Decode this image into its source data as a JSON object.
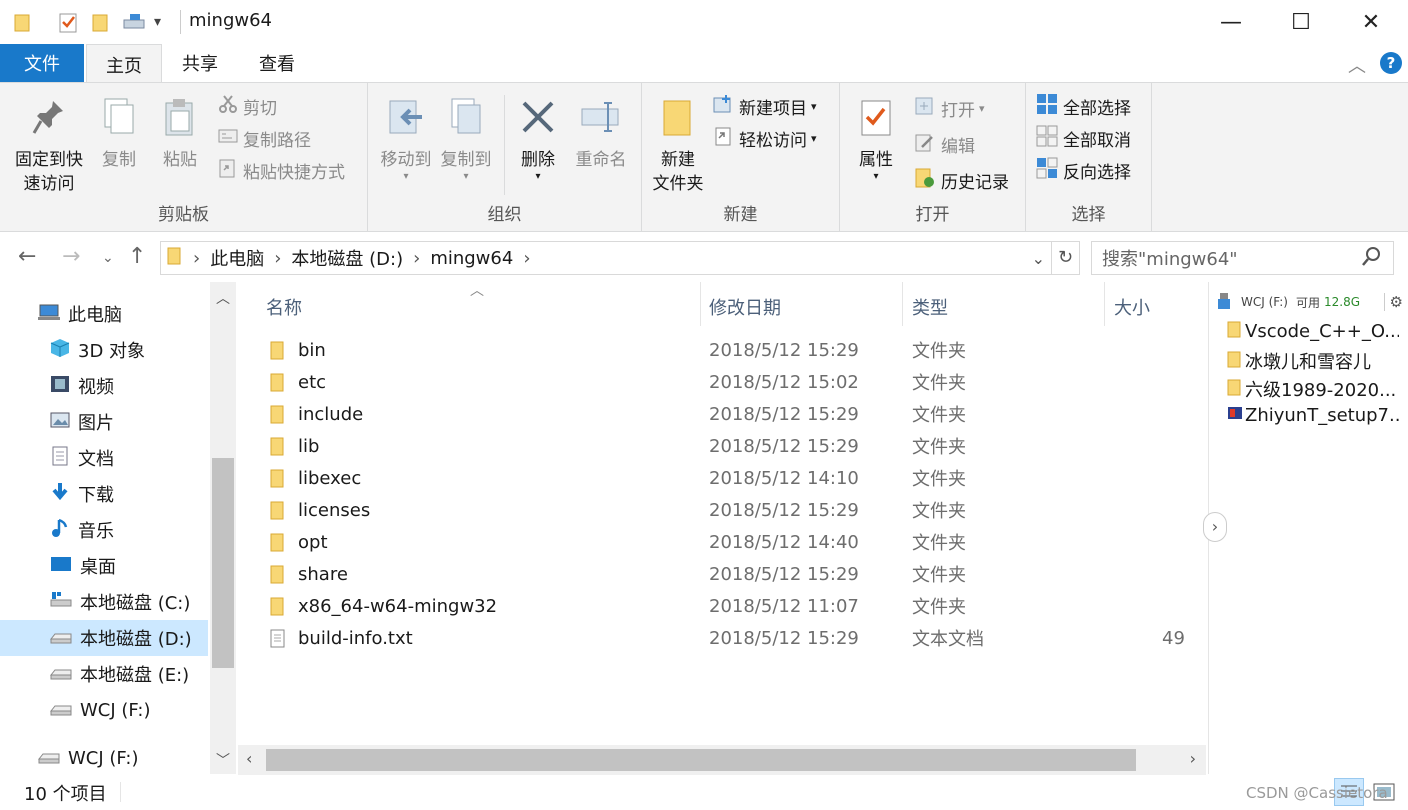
{
  "window": {
    "title": "mingw64",
    "minimize_glyph": "—",
    "maximize_glyph": "☐",
    "close_glyph": "✕"
  },
  "tabs": [
    {
      "label": "文件"
    },
    {
      "label": "主页"
    },
    {
      "label": "共享"
    },
    {
      "label": "查看"
    }
  ],
  "ribbon": {
    "clipboard": {
      "label": "剪贴板",
      "pin_line1": "固定到快",
      "pin_line2": "速访问",
      "copy": "复制",
      "paste": "粘贴",
      "cut": "剪切",
      "copy_path": "复制路径",
      "paste_shortcut": "粘贴快捷方式"
    },
    "organize": {
      "label": "组织",
      "move_to": "移动到",
      "copy_to": "复制到",
      "delete": "删除",
      "rename": "重命名"
    },
    "new": {
      "label": "新建",
      "new_folder_line1": "新建",
      "new_folder_line2": "文件夹",
      "new_item": "新建项目",
      "easy_access": "轻松访问"
    },
    "open": {
      "label": "打开",
      "properties": "属性",
      "open": "打开",
      "edit": "编辑",
      "history": "历史记录"
    },
    "select": {
      "label": "选择",
      "select_all": "全部选择",
      "select_none": "全部取消",
      "invert": "反向选择"
    }
  },
  "address": {
    "crumbs": [
      "此电脑",
      "本地磁盘 (D:)",
      "mingw64"
    ],
    "search_placeholder": "搜索\"mingw64\""
  },
  "nav_pane": [
    {
      "label": "此电脑",
      "icon": "computer-icon"
    },
    {
      "label": "3D 对象",
      "icon": "cube-icon"
    },
    {
      "label": "视频",
      "icon": "video-icon"
    },
    {
      "label": "图片",
      "icon": "picture-icon"
    },
    {
      "label": "文档",
      "icon": "document-icon"
    },
    {
      "label": "下载",
      "icon": "download-icon"
    },
    {
      "label": "音乐",
      "icon": "music-icon"
    },
    {
      "label": "桌面",
      "icon": "desktop-icon"
    },
    {
      "label": "本地磁盘 (C:)",
      "icon": "drive-icon"
    },
    {
      "label": "本地磁盘 (D:)",
      "icon": "drive-icon",
      "selected": true
    },
    {
      "label": "本地磁盘 (E:)",
      "icon": "drive-icon"
    },
    {
      "label": "WCJ (F:)",
      "icon": "usb-drive-icon"
    },
    {
      "label": "WCJ (F:)",
      "icon": "usb-drive-icon"
    }
  ],
  "columns": {
    "name": "名称",
    "date": "修改日期",
    "type": "类型",
    "size": "大小"
  },
  "files": [
    {
      "name": "bin",
      "date": "2018/5/12 15:29",
      "type": "文件夹",
      "size": ""
    },
    {
      "name": "etc",
      "date": "2018/5/12 15:02",
      "type": "文件夹",
      "size": ""
    },
    {
      "name": "include",
      "date": "2018/5/12 15:29",
      "type": "文件夹",
      "size": ""
    },
    {
      "name": "lib",
      "date": "2018/5/12 15:29",
      "type": "文件夹",
      "size": ""
    },
    {
      "name": "libexec",
      "date": "2018/5/12 14:10",
      "type": "文件夹",
      "size": ""
    },
    {
      "name": "licenses",
      "date": "2018/5/12 15:29",
      "type": "文件夹",
      "size": ""
    },
    {
      "name": "opt",
      "date": "2018/5/12 14:40",
      "type": "文件夹",
      "size": ""
    },
    {
      "name": "share",
      "date": "2018/5/12 15:29",
      "type": "文件夹",
      "size": ""
    },
    {
      "name": "x86_64-w64-mingw32",
      "date": "2018/5/12 11:07",
      "type": "文件夹",
      "size": ""
    },
    {
      "name": "build-info.txt",
      "date": "2018/5/12 15:29",
      "type": "文本文档",
      "size": "49"
    }
  ],
  "side_panel": {
    "drive": "WCJ (F:)",
    "free_label": "可用",
    "free_value": "12.8G",
    "items": [
      "Vscode_C++_O...",
      "冰墩儿和雪容儿",
      "六级1989-2020...",
      "ZhiyunT_setup7..."
    ]
  },
  "status": {
    "count": "10 个项目",
    "watermark": "CSDN @Cassietora"
  },
  "colors": {
    "accent": "#1979ca",
    "folder": "#f8d775",
    "selected": "#cce8ff",
    "free_green": "#2a8a2a"
  }
}
